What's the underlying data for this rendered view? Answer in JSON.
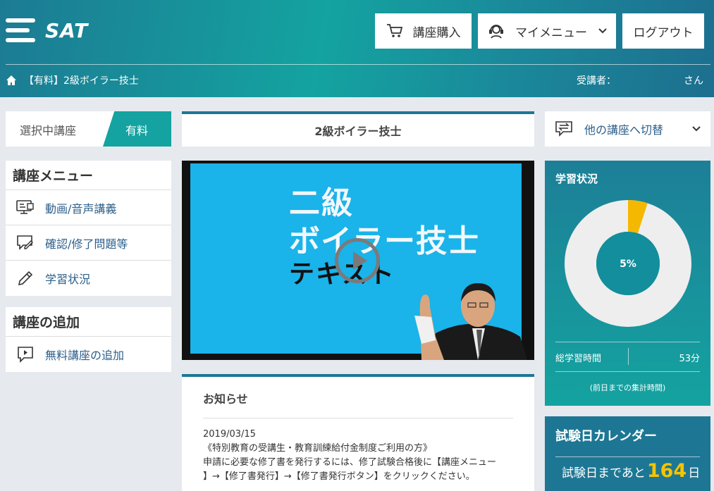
{
  "header": {
    "logo_text": "SAT",
    "buttons": {
      "purchase": "講座購入",
      "mymenu": "マイメニュー",
      "logout": "ログアウト"
    },
    "breadcrumb": "【有料】2級ボイラー技士",
    "student_label": "受講者：",
    "student_suffix": "さん"
  },
  "sidebar": {
    "selected_label": "選択中講座",
    "selected_tag": "有料",
    "course_menu_title": "講座メニュー",
    "course_menu_items": [
      {
        "label": "動画/音声講義",
        "icon": "monitor-icon"
      },
      {
        "label": "確認/修了問題等",
        "icon": "chat-pencil-icon"
      },
      {
        "label": "学習状況",
        "icon": "pencil-icon"
      }
    ],
    "add_title": "講座の追加",
    "add_items": [
      {
        "label": "無料講座の追加",
        "icon": "play-chat-icon"
      }
    ]
  },
  "main": {
    "course_title": "2級ボイラー技士",
    "video": {
      "line1": "二級",
      "line2": "ボイラー技士",
      "line3": "テキスト"
    },
    "notice": {
      "title": "お知らせ",
      "date": "2019/03/15",
      "line1": "《特別教育の受講生・教育訓練給付金制度ご利用の方》",
      "line2": "申請に必要な修了書を発行するには、修了試験合格後に【講座メニュー",
      "line3": "】→【修了書発行】→【修了書発行ボタン】をクリックください。"
    }
  },
  "right": {
    "switch_label": "他の講座へ切替",
    "progress": {
      "title": "学習状況",
      "percent": 5,
      "percent_label": "5%",
      "total_time_label": "総学習時間",
      "total_time_value": "53分",
      "note": "(前日までの集計時間)"
    },
    "calendar": {
      "title": "試験日カレンダー",
      "prefix": "試験日まであと",
      "days": "164",
      "suffix": "日"
    }
  },
  "colors": {
    "teal": "#14a3a0",
    "blue": "#1d7794",
    "donut_track": "#eeeeee",
    "donut_fill": "#f5b800",
    "link": "#2c5f8a"
  }
}
